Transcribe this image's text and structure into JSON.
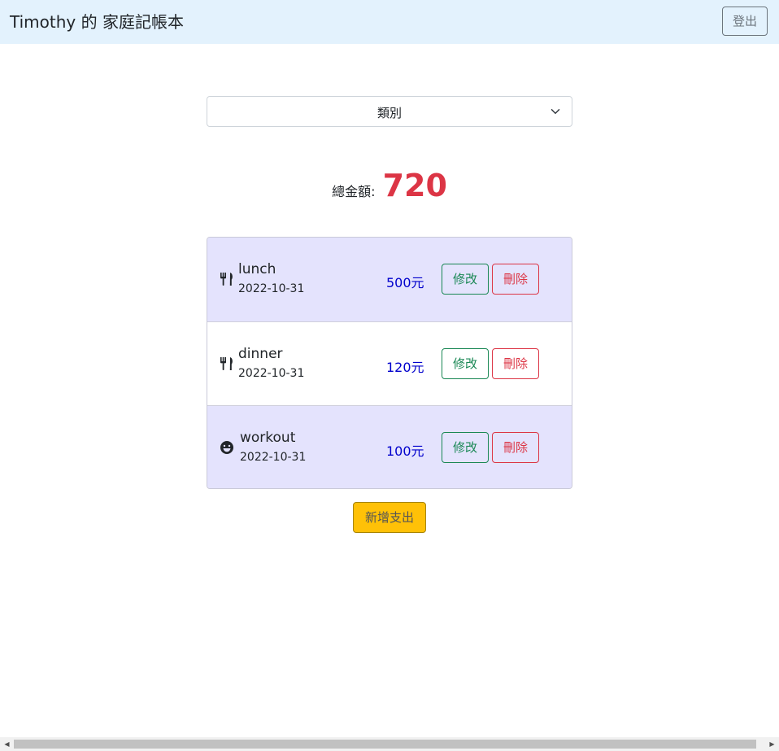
{
  "navbar": {
    "brand": "Timothy 的 家庭記帳本",
    "logout_label": "登出"
  },
  "filter": {
    "category_label": "類別",
    "chevron_icon": "chevron-down-icon"
  },
  "total": {
    "label": "總金額:",
    "value": "720"
  },
  "expenses": [
    {
      "icon": "fork-knife-icon",
      "name": "lunch",
      "date": "2022-10-31",
      "amount": "500元",
      "edit_label": "修改",
      "delete_label": "刪除"
    },
    {
      "icon": "fork-knife-icon",
      "name": "dinner",
      "date": "2022-10-31",
      "amount": "120元",
      "edit_label": "修改",
      "delete_label": "刪除"
    },
    {
      "icon": "smile-icon",
      "name": "workout",
      "date": "2022-10-31",
      "amount": "100元",
      "edit_label": "修改",
      "delete_label": "刪除"
    }
  ],
  "add_button": {
    "label": "新增支出"
  },
  "colors": {
    "navbar_bg": "#e3f2fd",
    "row_highlight": "#e4e3fd",
    "total_value": "#dc3545",
    "amount": "#0000cc",
    "edit": "#198754",
    "delete": "#dc3545",
    "add_button": "#ffc107"
  }
}
